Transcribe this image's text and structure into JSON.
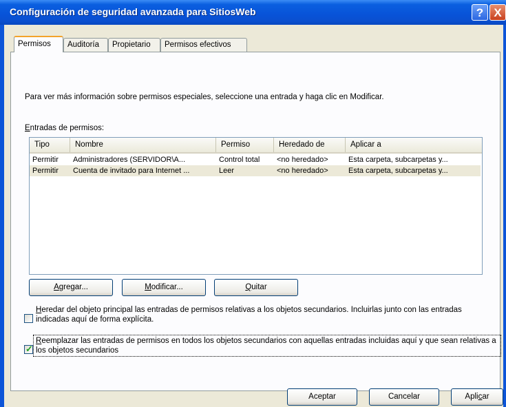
{
  "window": {
    "title": "Configuración de seguridad avanzada para SitiosWeb",
    "help_label": "?",
    "close_label": "X"
  },
  "tabs": [
    {
      "label": "Permisos"
    },
    {
      "label": "Auditoría"
    },
    {
      "label": "Propietario"
    },
    {
      "label": "Permisos efectivos"
    }
  ],
  "panel": {
    "info_text": "Para ver más información sobre permisos especiales, seleccione una entrada y haga clic en Modificar.",
    "entries_label_first": "E",
    "entries_label_rest": "ntradas de permisos:"
  },
  "table": {
    "columns": [
      "Tipo",
      "Nombre",
      "Permiso",
      "Heredado de",
      "Aplicar a"
    ],
    "rows": [
      [
        "Permitir",
        "Administradores (SERVIDOR\\A...",
        "Control total",
        "<no heredado>",
        "Esta carpeta, subcarpetas y..."
      ],
      [
        "Permitir",
        "Cuenta de invitado para Internet ...",
        "Leer",
        "<no heredado>",
        "Esta carpeta, subcarpetas y..."
      ]
    ]
  },
  "buttons": {
    "add": {
      "first": "A",
      "rest": "gregar..."
    },
    "edit": {
      "first": "M",
      "rest": "odificar..."
    },
    "remove": {
      "first": "Q",
      "rest": "uitar"
    },
    "ok": "Aceptar",
    "cancel": "Cancelar",
    "apply": {
      "before": "Apli",
      "under": "c",
      "after": "ar"
    }
  },
  "checkboxes": {
    "inherit": {
      "checked": false,
      "first": "H",
      "rest": "eredar del objeto principal las entradas de permisos relativas a los objetos secundarios. Incluirlas junto con las entradas indicadas aquí de forma explícita."
    },
    "replace": {
      "checked": true,
      "first": "R",
      "rest": "eemplazar las entradas de permisos en todos los objetos secundarios con aquellas entradas incluidas aquí y que sean relativas a los objetos secundarios"
    }
  },
  "colors": {
    "title_bar": "#0853d8",
    "tab_active_accent": "#f3a32a",
    "dialog_face": "#ece9d8",
    "check_mark": "#21a121"
  }
}
